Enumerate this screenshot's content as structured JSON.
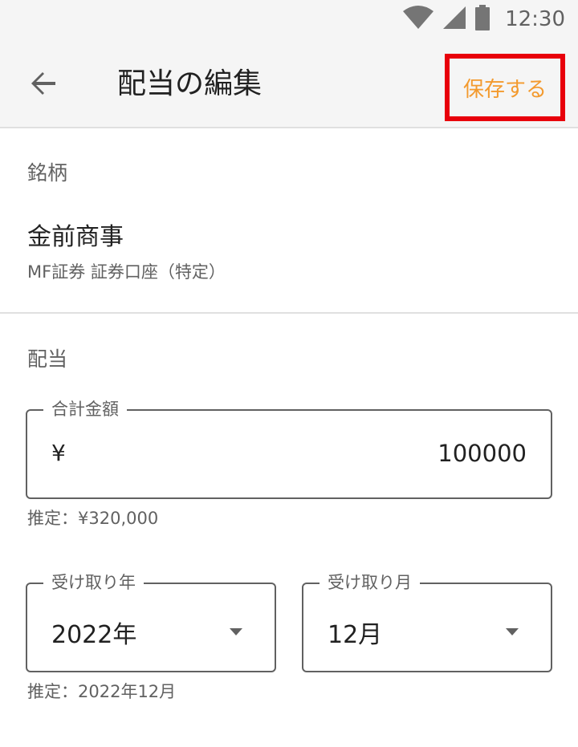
{
  "status_bar": {
    "time": "12:30",
    "icons": [
      "wifi-icon",
      "signal-icon",
      "battery-icon"
    ]
  },
  "app_bar": {
    "title": "配当の編集",
    "save_label": "保存する",
    "back_icon": "arrow-left-icon"
  },
  "stock_section": {
    "label": "銘柄",
    "name": "金前商事",
    "account": "MF証券 証券口座（特定）"
  },
  "dividend_section": {
    "label": "配当",
    "total_amount": {
      "label": "合計金額",
      "currency": "¥",
      "value": "100000",
      "helper": "推定：¥320,000"
    },
    "year_select": {
      "label": "受け取り年",
      "value": "2022年"
    },
    "month_select": {
      "label": "受け取り月",
      "value": "12月"
    },
    "date_helper": "推定：2022年12月"
  },
  "colors": {
    "accent": "#f39a2e",
    "highlight": "#e8000b",
    "text_primary": "#212121",
    "text_secondary": "#616161"
  }
}
